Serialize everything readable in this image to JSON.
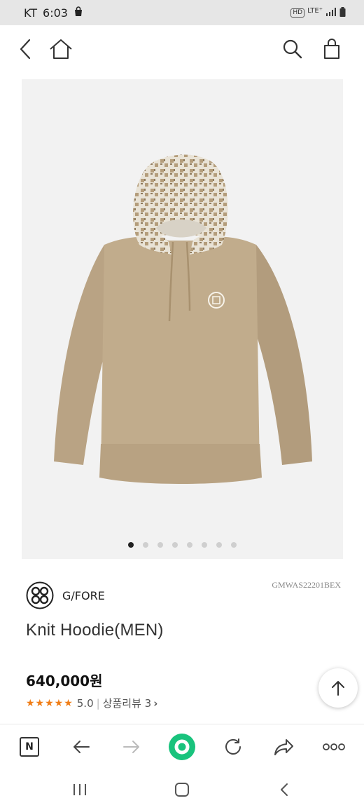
{
  "status_bar": {
    "carrier": "KT",
    "time": "6:03",
    "hd": "HD",
    "network": "LTE⁺",
    "icons": [
      "shopping-bag-icon",
      "signal-icon",
      "battery-icon"
    ]
  },
  "top_nav": {
    "icons": [
      "back-arrow-icon",
      "home-icon",
      "search-icon",
      "cart-bag-icon"
    ]
  },
  "gallery": {
    "image_count": 8,
    "active_index": 0,
    "garment_color": "#bfa98a"
  },
  "product": {
    "brand": "G/FORE",
    "code": "GMWAS22201BEX",
    "title": "Knit Hoodie(MEN)",
    "price": "640,000원",
    "stars": "★★★★★",
    "rating": "5.0",
    "review_label": "상품리뷰 3",
    "review_chevron": "›",
    "review_sep": "|"
  },
  "browser_toolbar": {
    "n_label": "N",
    "icons": [
      "n-tab-icon",
      "back-icon",
      "forward-icon",
      "green-dot-icon",
      "refresh-icon",
      "share-icon",
      "more-icon"
    ]
  },
  "colors": {
    "accent_star": "#f07d16",
    "green_button": "#19c37d",
    "status_bar_bg": "#e6e6e6"
  }
}
